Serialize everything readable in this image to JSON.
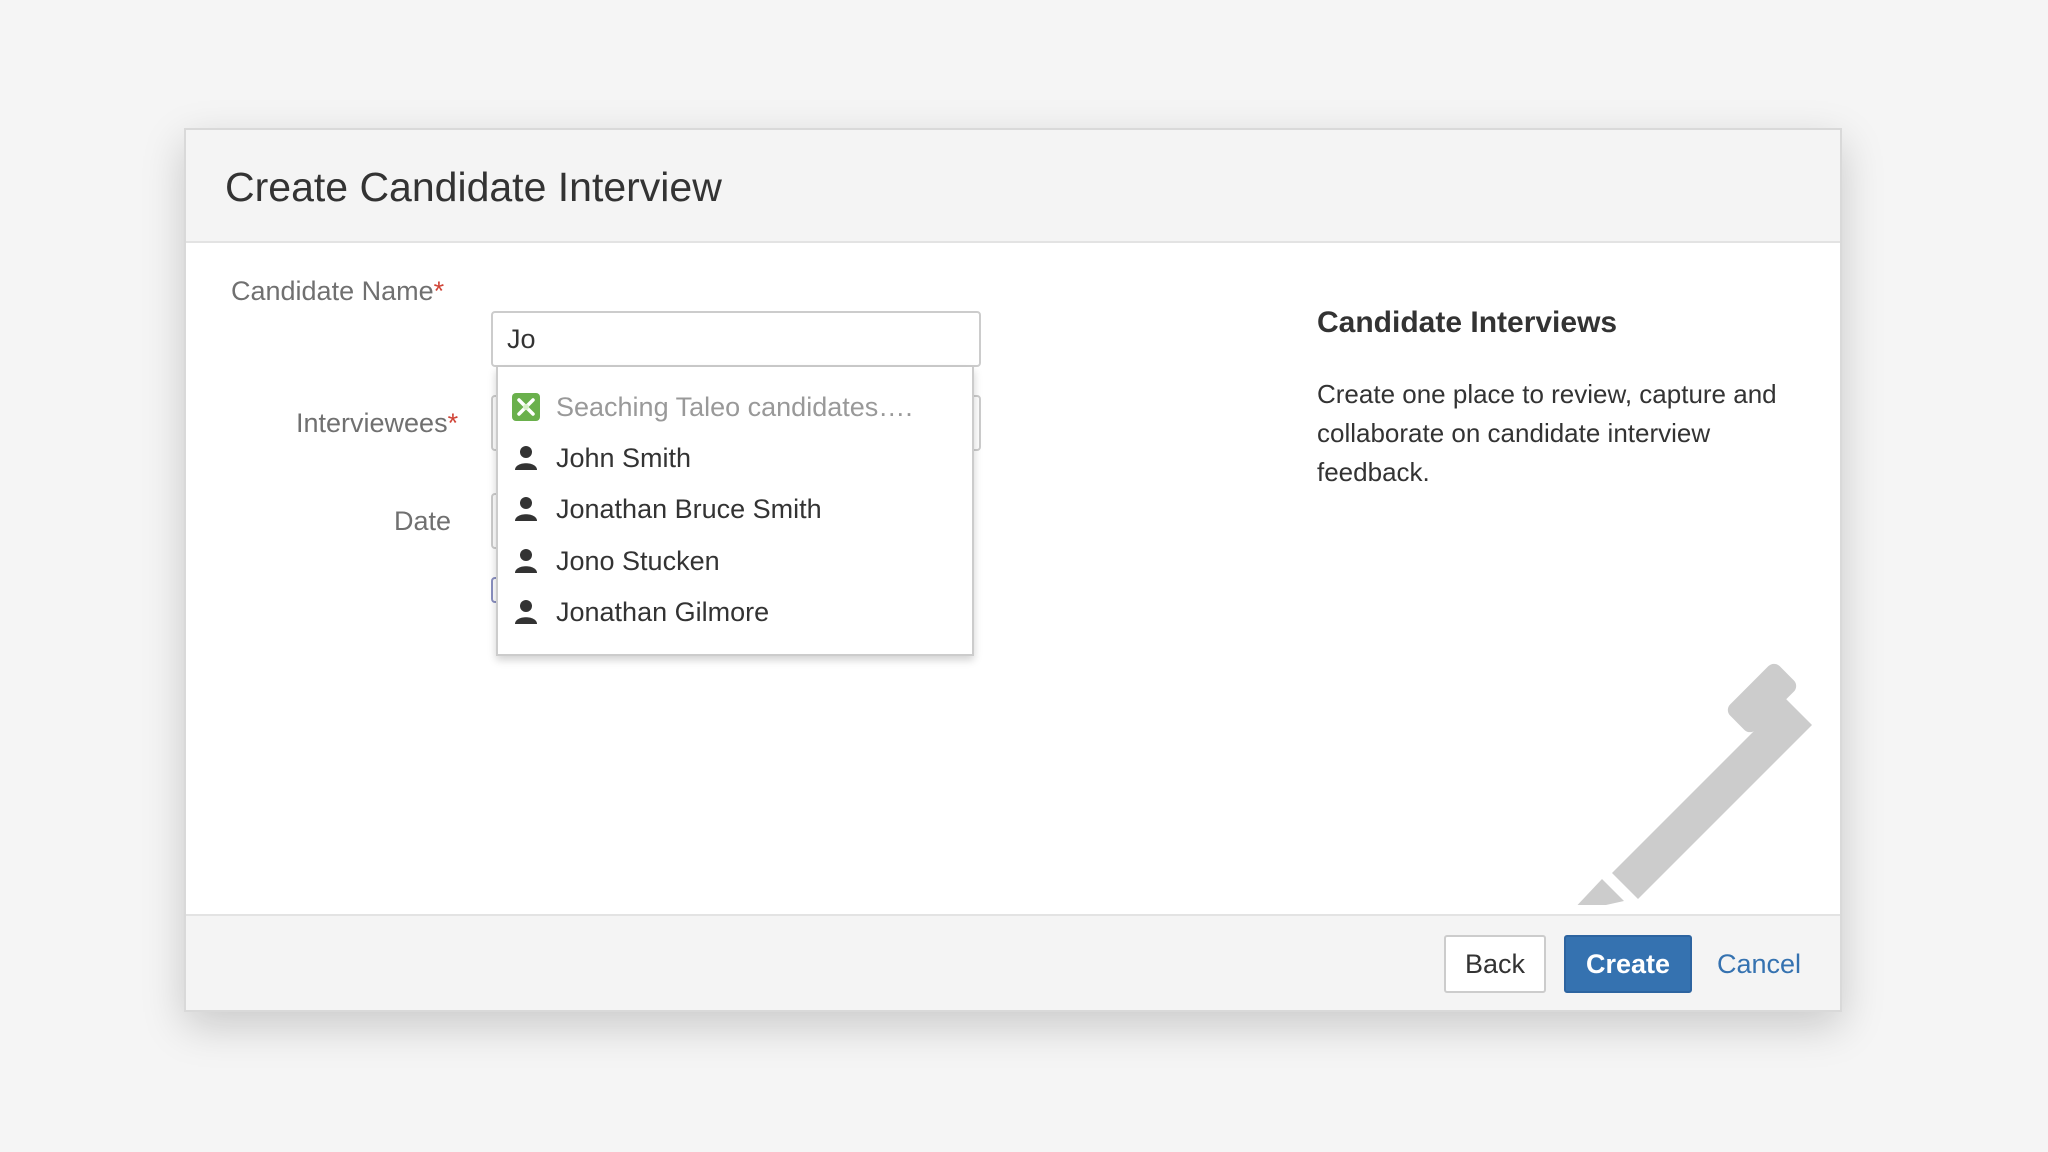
{
  "dialog": {
    "title": "Create Candidate Interview"
  },
  "form": {
    "candidate_name": {
      "label": "Candidate Name",
      "required_marker": "*",
      "value": "Jo"
    },
    "interviewees": {
      "label": "Interviewees",
      "required_marker": "*"
    },
    "date": {
      "label": "Date"
    }
  },
  "autocomplete": {
    "loading_text": "Seaching Taleo candidates….",
    "loading_icon": "taleo-logo-icon",
    "item_icon": "user-icon",
    "items": [
      "John Smith",
      "Jonathan Bruce Smith",
      "Jono Stucken",
      "Jonathan Gilmore"
    ]
  },
  "sidebar": {
    "title": "Candidate Interviews",
    "description": "Create one place to review, capture and collaborate on candidate interview feedback.",
    "illustration_icon": "pencil-icon"
  },
  "footer": {
    "back_label": "Back",
    "create_label": "Create",
    "cancel_label": "Cancel"
  },
  "colors": {
    "primary": "#3572b0",
    "required": "#d04437",
    "taleo_green": "#6ab04c",
    "pencil_gray": "#cccccc"
  }
}
